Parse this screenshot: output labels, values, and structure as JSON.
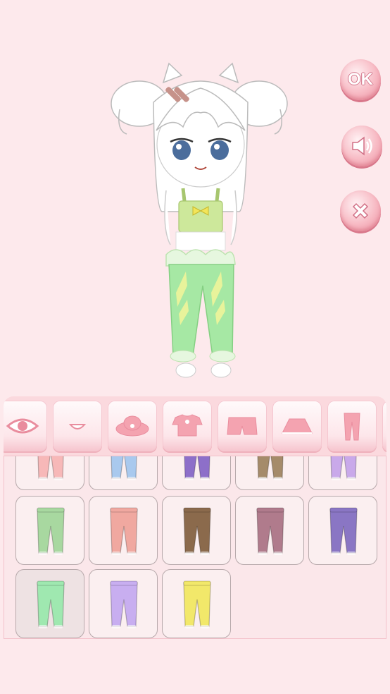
{
  "buttons": {
    "ok_label": "OK",
    "sound_icon": "speaker-icon",
    "close_icon": "close-icon"
  },
  "categories": [
    {
      "icon": "eye-icon"
    },
    {
      "icon": "mouth-icon"
    },
    {
      "icon": "hat-icon"
    },
    {
      "icon": "shirt-icon"
    },
    {
      "icon": "shorts-icon"
    },
    {
      "icon": "skirt-icon"
    },
    {
      "icon": "leggings-icon"
    }
  ],
  "pants_items": [
    {
      "color": "#f7b8b8"
    },
    {
      "color": "#a9c9ee"
    },
    {
      "color": "#8d6fc9"
    },
    {
      "color": "#a58b6a"
    },
    {
      "color": "#c9a9ea"
    },
    {
      "color": "#a8d8a0"
    },
    {
      "color": "#f0a8a0"
    },
    {
      "color": "#8b6a4c"
    },
    {
      "color": "#b07b8c"
    },
    {
      "color": "#8a76c4"
    },
    {
      "color": "#9fe8b0"
    },
    {
      "color": "#c8aef0"
    },
    {
      "color": "#f2e86a"
    }
  ],
  "colors": {
    "background": "#fde9ec",
    "accent": "#e98d9e",
    "outfit_green": "#a6e8a4"
  }
}
